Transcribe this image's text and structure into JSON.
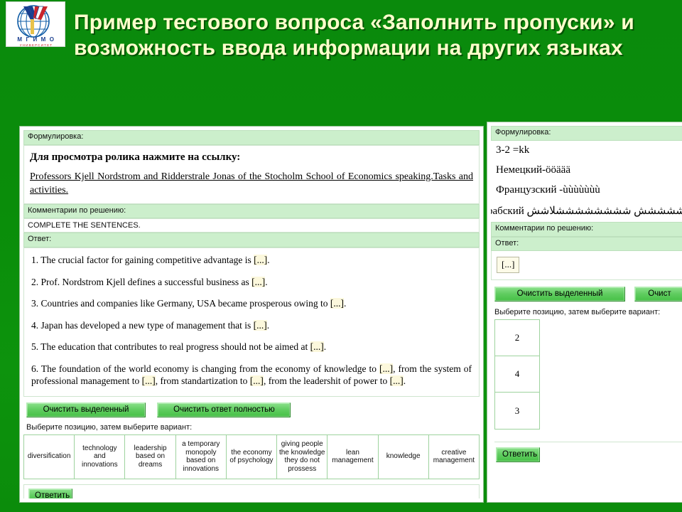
{
  "slide": {
    "background_color": "#0a8d0a",
    "title_color": "#ffffcc",
    "title": "Пример тестового вопроса «Заполнить пропуски» и возможность ввода информации на других языках",
    "logo_alt": "МГИМО",
    "logo_text_main": "М Г И М О",
    "logo_text_sub": "УНИВЕРСИТЕТ"
  },
  "left_panel": {
    "formulation_label": "Формулировка:",
    "question_title": "Для просмотра ролика нажмите на ссылку:",
    "question_link": "Professors Kjell Nordstrom and Ridderstrale Jonas of the Stocholm School of Economics speaking.Tasks and activities.",
    "comments_label": "Комментарии по решению:",
    "comments_value": "COMPLETE THE SENTENCES.",
    "answer_label": "Ответ:",
    "answer_lines": [
      "1. The crucial factor for gaining competitive advantage is [...].",
      "2. Prof. Nordstrom Kjell defines a successful business as [...].",
      "3. Countries and companies like Germany, USA became prosperous owing to [...].",
      "4. Japan has developed a new type of management that is [...].",
      "5. The education that contributes to real progress should not be aimed at [...].",
      "6. The foundation of the world economy is changing from the economy of knowledge to [...], from the system of professional management to [...], from standartization to [...], from the leadershit of power to [...]."
    ],
    "clear_selected_label": "Очистить выделенный",
    "clear_all_label": "Очистить ответ полностью",
    "choose_hint": "Выберите позицию, затем выберите вариант:",
    "options": [
      "diversification",
      "technology and innovations",
      "leadership based on dreams",
      "a temporary monopoly based on innovations",
      "the economy of psychology",
      "giving people the knowledge they do not prossess",
      "lean management",
      "knowledge",
      "creative management"
    ],
    "submit_label": "Ответить"
  },
  "right_panel": {
    "formulation_label": "Формулировка:",
    "formula_lines": [
      "3-2 =kk",
      "Немецкий-ööäää",
      "Французский -ùùùùùùù"
    ],
    "arabic_line_label": "Арабский",
    "arabic_line_text": "ششششش ششششششششلاشش",
    "comments_label": "Комментарии по решению:",
    "answer_label": "Ответ:",
    "answer_chip": "[...]",
    "clear_selected_label": "Очистить выделенный",
    "clear_all_label": "Очист",
    "choose_hint": "Выберите позицию, затем выберите вариант:",
    "positions": [
      "2",
      "4",
      "3"
    ],
    "submit_label": "Ответить"
  }
}
